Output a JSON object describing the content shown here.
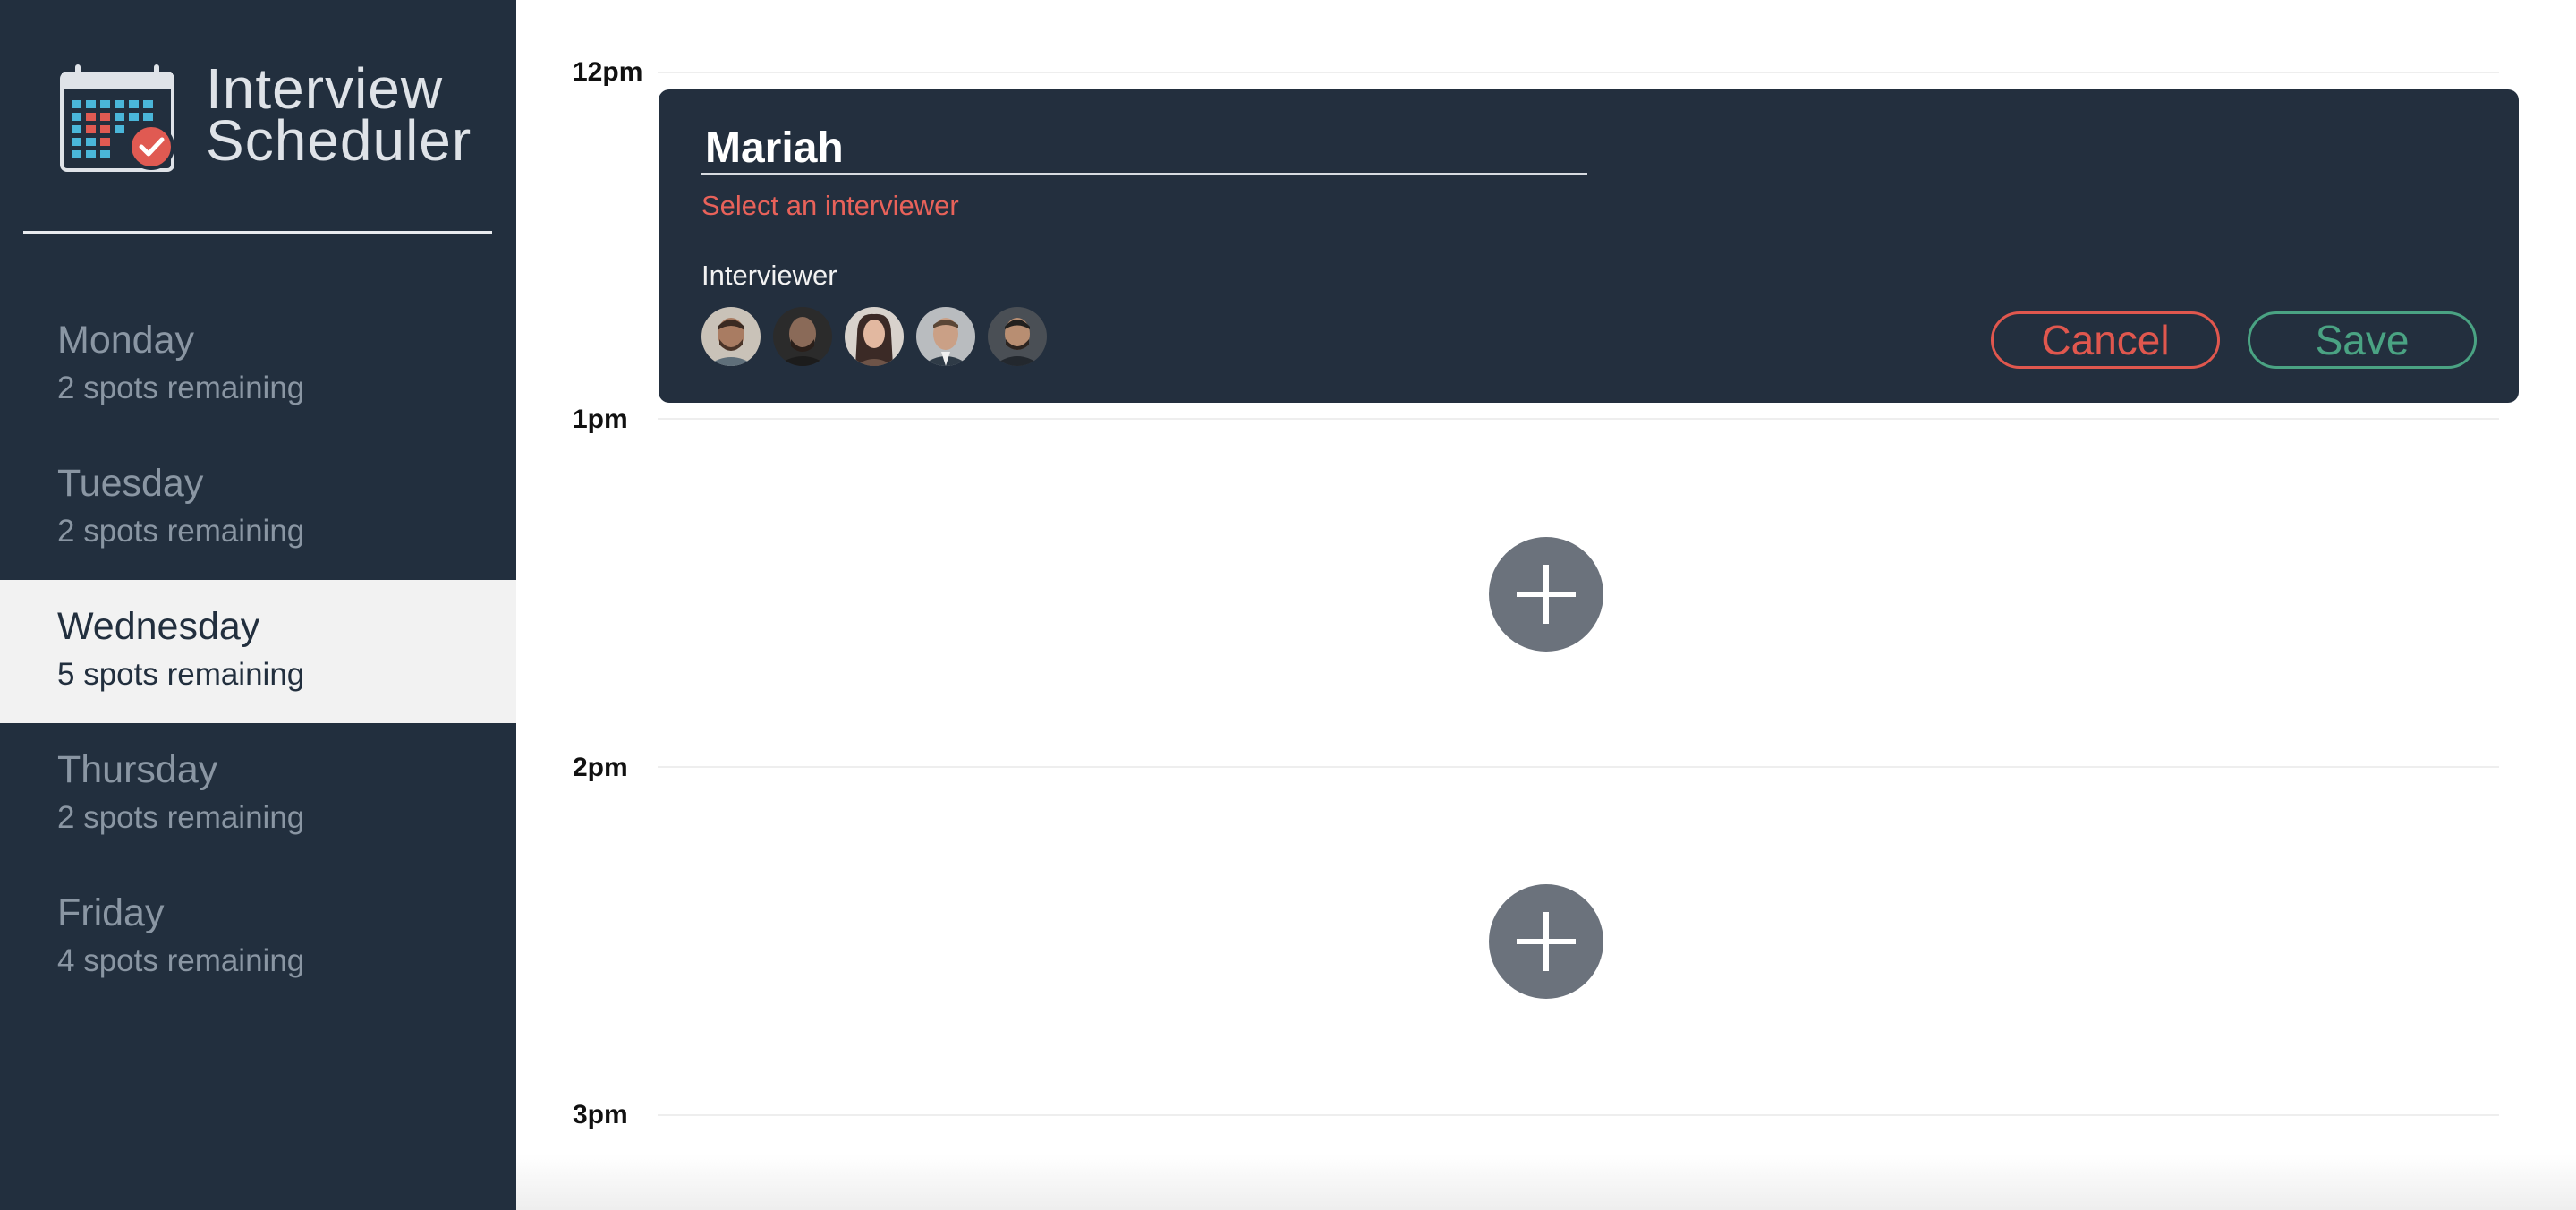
{
  "brand": {
    "line1": "Interview",
    "line2": "Scheduler",
    "logo_icon": "calendar-check-icon"
  },
  "days": [
    {
      "name": "Monday",
      "spots": "2 spots remaining",
      "selected": false
    },
    {
      "name": "Tuesday",
      "spots": "2 spots remaining",
      "selected": false
    },
    {
      "name": "Wednesday",
      "spots": "5 spots remaining",
      "selected": true
    },
    {
      "name": "Thursday",
      "spots": "2 spots remaining",
      "selected": false
    },
    {
      "name": "Friday",
      "spots": "4 spots remaining",
      "selected": false
    }
  ],
  "schedule": {
    "times": [
      "12pm",
      "1pm",
      "2pm",
      "3pm"
    ]
  },
  "form": {
    "student_name": "Mariah",
    "error": "Select an interviewer",
    "interviewer_label": "Interviewer",
    "interviewers": [
      {
        "icon": "interviewer-avatar-1"
      },
      {
        "icon": "interviewer-avatar-2"
      },
      {
        "icon": "interviewer-avatar-3"
      },
      {
        "icon": "interviewer-avatar-4"
      },
      {
        "icon": "interviewer-avatar-5"
      }
    ],
    "cancel_label": "Cancel",
    "save_label": "Save"
  },
  "colors": {
    "sidebar_bg": "#222f3e",
    "card_bg": "#232f3e",
    "error": "#e8625a",
    "cancel": "#e0574e",
    "save": "#4aa383",
    "add_button": "#6b727c"
  }
}
